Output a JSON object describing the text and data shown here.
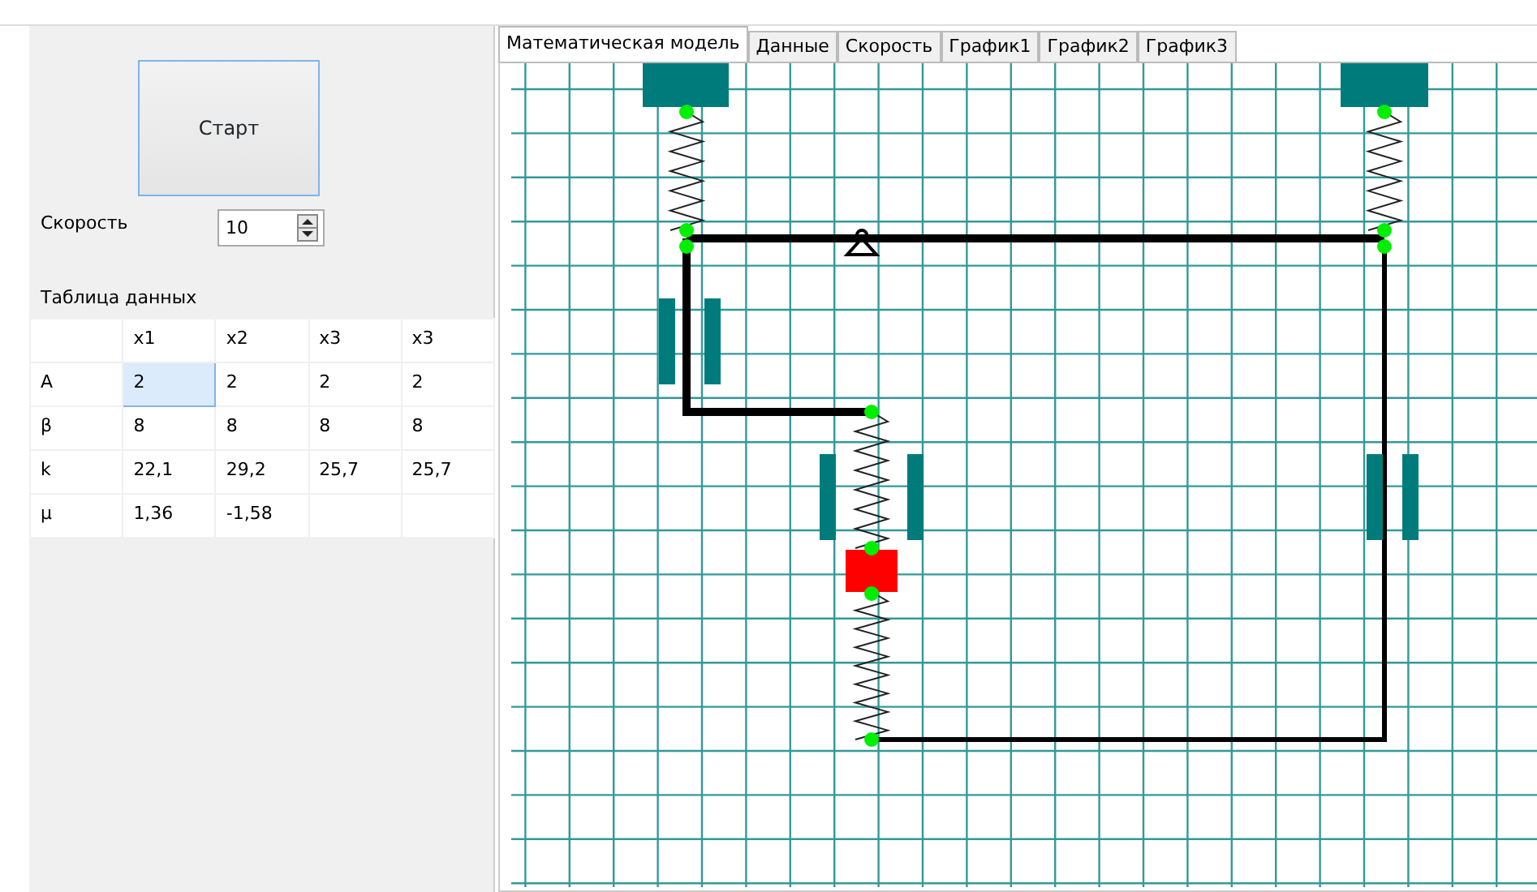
{
  "start_button": {
    "label": "Старт"
  },
  "speed": {
    "label": "Скорость",
    "value": "10"
  },
  "data_table": {
    "title": "Таблица данных",
    "columns": [
      "x1",
      "x2",
      "x3",
      "x3"
    ],
    "rows": [
      {
        "label": "A",
        "cells": [
          {
            "text": "2",
            "selected": true
          },
          {
            "text": "2",
            "selected": false
          },
          {
            "text": "2",
            "selected": false
          },
          {
            "text": "2",
            "selected": false
          }
        ]
      },
      {
        "label": "β",
        "cells": [
          {
            "text": "8",
            "selected": false
          },
          {
            "text": "8",
            "selected": false
          },
          {
            "text": "8",
            "selected": false
          },
          {
            "text": "8",
            "selected": false
          }
        ]
      },
      {
        "label": "k",
        "cells": [
          {
            "text": "22,1",
            "selected": false
          },
          {
            "text": "29,2",
            "selected": false
          },
          {
            "text": "25,7",
            "selected": false
          },
          {
            "text": "25,7",
            "selected": false
          }
        ]
      },
      {
        "label": "μ",
        "cells": [
          {
            "text": "1,36",
            "selected": false
          },
          {
            "text": "-1,58",
            "selected": false
          }
        ]
      }
    ]
  },
  "tabs": [
    {
      "label": "Математическая модель",
      "selected": true
    },
    {
      "label": "Данные",
      "selected": false
    },
    {
      "label": "Скорость",
      "selected": false
    },
    {
      "label": "График1",
      "selected": false
    },
    {
      "label": "График2",
      "selected": false
    },
    {
      "label": "График3",
      "selected": false
    }
  ]
}
